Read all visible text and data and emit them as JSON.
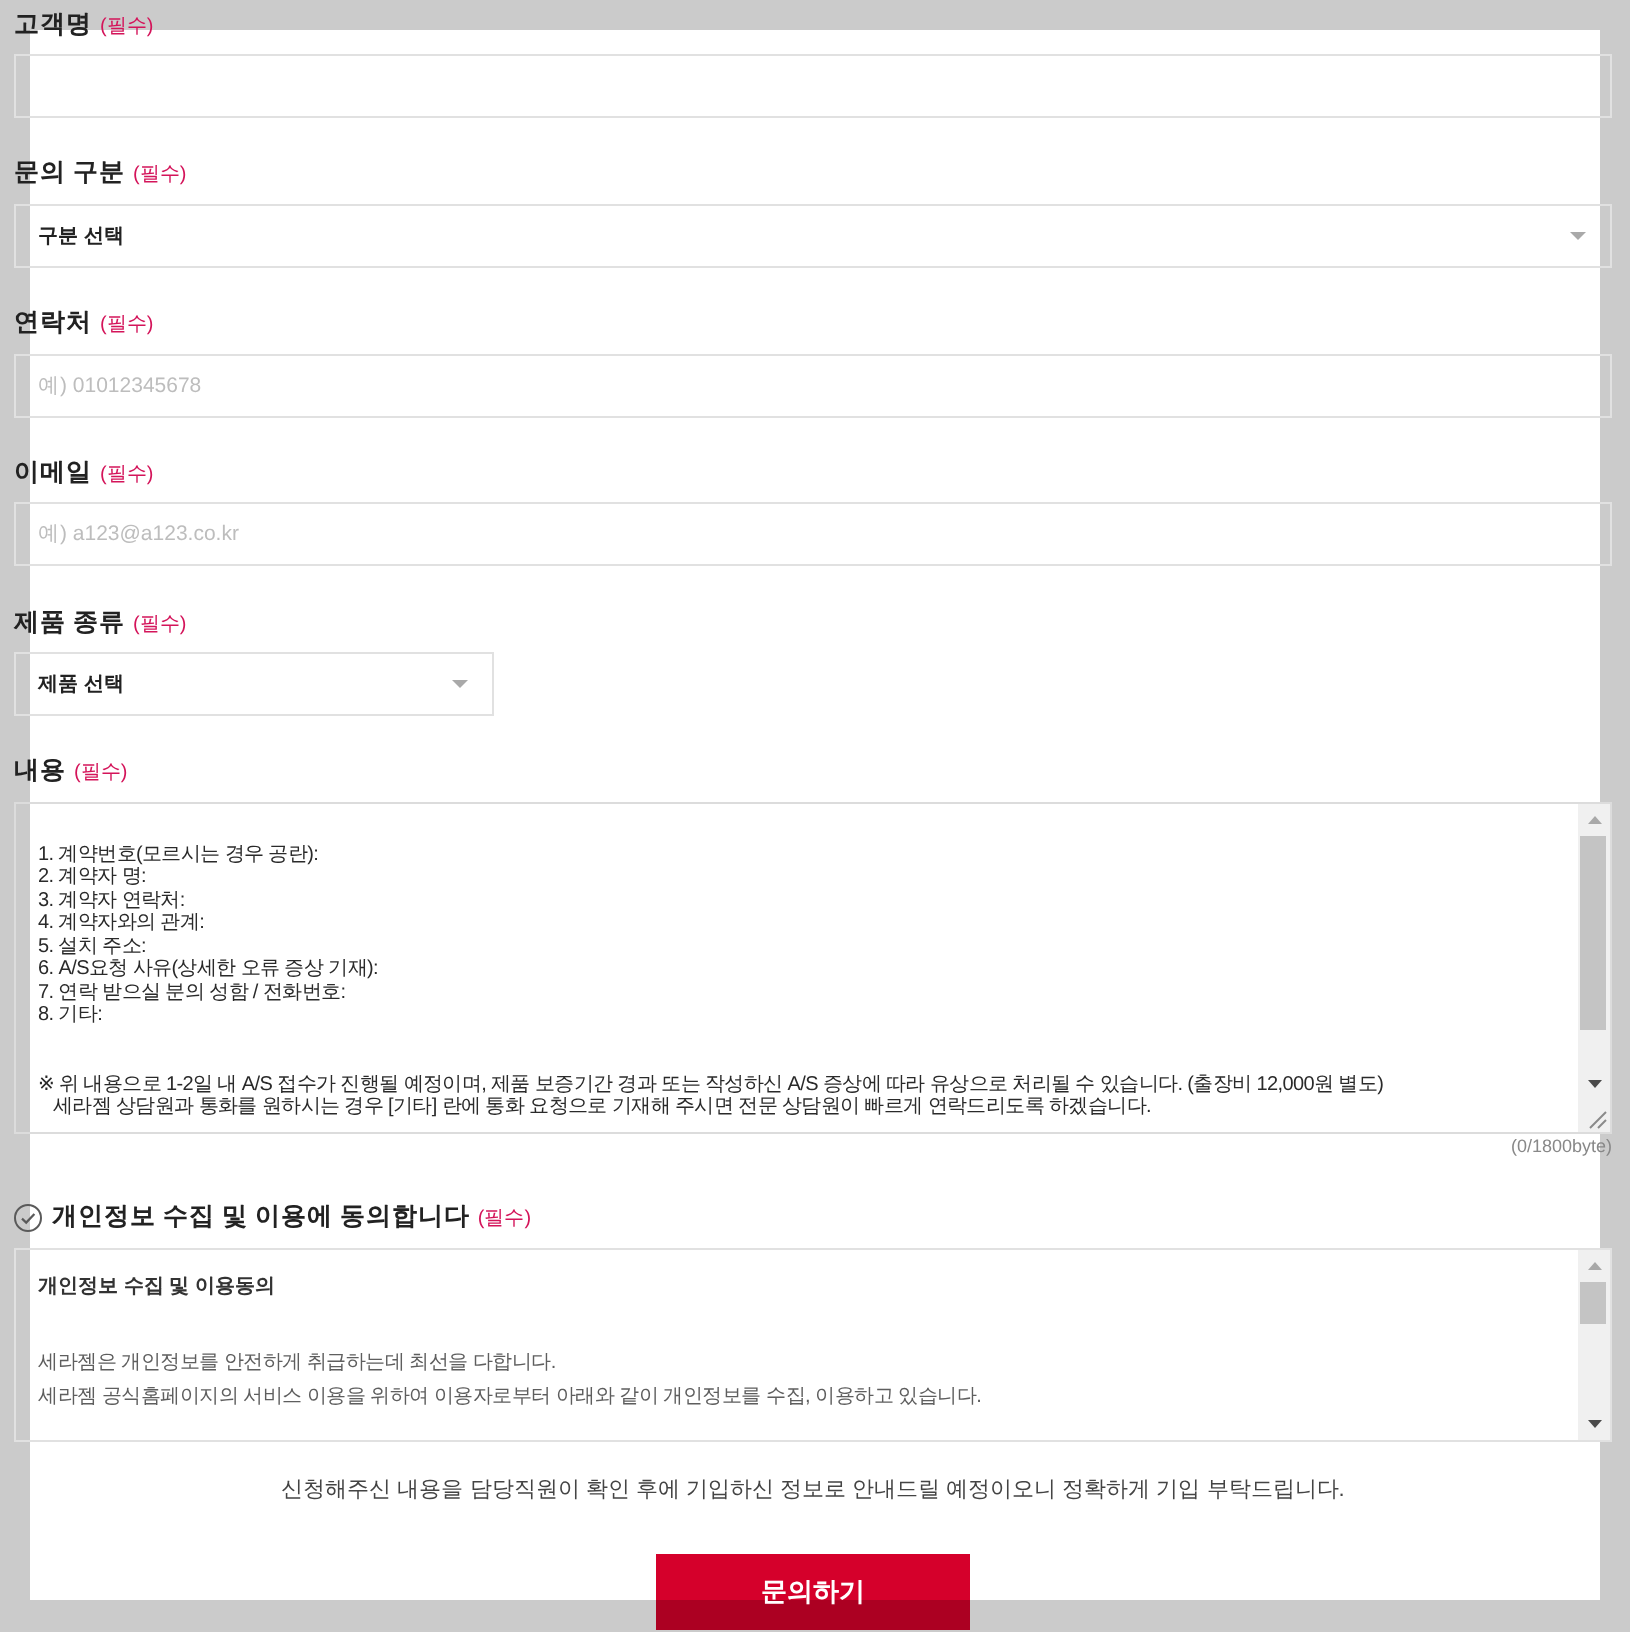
{
  "fields": [
    {
      "kind": "text",
      "label": "고객명",
      "required_mark": "(필수)"
    },
    {
      "kind": "select",
      "label": "문의 구분",
      "required_mark": "(필수)",
      "value": "구분 선택"
    },
    {
      "kind": "text",
      "label": "연락처",
      "required_mark": "(필수)",
      "placeholder": "예) 01012345678"
    },
    {
      "kind": "text",
      "label": "이메일",
      "required_mark": "(필수)",
      "placeholder": "예) a123@a123.co.kr"
    },
    {
      "kind": "select",
      "label": "제품 종류",
      "required_mark": "(필수)",
      "value": "제품 선택"
    },
    {
      "kind": "textarea",
      "label": "내용",
      "required_mark": "(필수)",
      "placeholder": "1. 계약번호(모르시는 경우 공란):\n2. 계약자 명:\n3. 계약자 연락처:\n4. 계약자와의 관계:\n5. 설치 주소:\n6. A/S요청 사유(상세한 오류 증상 기재):\n7. 연락 받으실 분의 성함 / 전화번호:\n8. 기타:\n\n\n※ 위 내용으로 1-2일 내 A/S 접수가 진행될 예정이며, 제품 보증기간 경과 또는 작성하신 A/S 증상에 따라 유상으로 처리될 수 있습니다. (출장비 12,000원 별도)\n   세라젬 상담원과 통화를 원하시는 경우 [기타] 란에 통화 요청으로 기재해 주시면 전문 상담원이 빠르게 연락드리도록 하겠습니다.",
      "counter": "(0/1800byte)"
    }
  ],
  "consent": {
    "checked": false,
    "label": "개인정보 수집 및 이용에 동의합니다",
    "required_mark": "(필수)",
    "terms_title": "개인정보 수집 및 이용동의",
    "terms_paragraphs": [
      "세라젬은 개인정보를 안전하게 취급하는데 최선을 다합니다.",
      "세라젬 공식홈페이지의 서비스 이용을 위하여 이용자로부터 아래와 같이 개인정보를 수집, 이용하고 있습니다."
    ]
  },
  "notice": "신청해주신 내용을 담당직원이 확인 후에 기입하신 정보로 안내드릴 예정이오니 정확하게 기입 부탁드립니다.",
  "submit_button": "문의하기"
}
